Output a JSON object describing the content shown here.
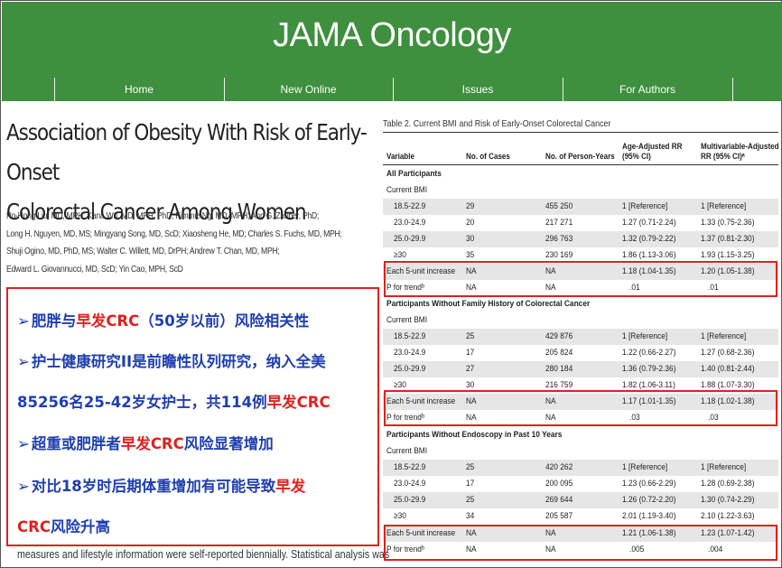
{
  "header": {
    "journal": "JAMA Oncology",
    "nav": [
      "Home",
      "New Online",
      "Issues",
      "For Authors"
    ]
  },
  "article": {
    "title_line1": "Association of Obesity With Risk of Early-Onset",
    "title_line2": "Colorectal Cancer Among Women",
    "authors": [
      "Po-Hong Liu, MD, MPH; Kana Wu, MD, MPH, PhD; Kimmie Ng, MD, MPH; Ann G. Zauber, PhD;",
      "Long H. Nguyen, MD, MS; Mingyang Song, MD, ScD; Xiaosheng He, MD; Charles S. Fuchs, MD, MPH;",
      "Shuji Ogino, MD, PhD, MS; Walter C. Willett, MD, DrPH; Andrew T. Chan, MD, MPH;",
      "Edward L. Giovannucci, MD, ScD; Yin Cao, MPH, ScD"
    ],
    "cutoff_text": "measures and lifestyle information were self-reported biennially. Statistical analysis was"
  },
  "summary": {
    "b1_a": "肥胖与",
    "b1_r": "早发CRC",
    "b1_b": "（50岁以前）风险相关性",
    "b2": "护士健康研究II是前瞻性队列研究，纳入全美",
    "b2_cont_a": "85256名25-42岁女护士，共114例",
    "b2_cont_r": "早发CRC",
    "b3_a": "超重或肥胖者",
    "b3_r": "早发CRC",
    "b3_b": "风险显著增加",
    "b4_a": "对比18岁时后期体重增加有可能导致",
    "b4_r": "早发",
    "b4_cont_r": "CRC",
    "b4_cont_b": "风险升高",
    "arrow": "➢"
  },
  "table": {
    "caption": "Table 2. Current BMI and Risk of Early-Onset Colorectal Cancer",
    "headers": {
      "variable": "Variable",
      "cases": "No. of Cases",
      "person_years": "No. of Person-Years",
      "age_adj_1": "Age-Adjusted RR",
      "age_adj_2": "(95% CI)",
      "multi_1": "Multivariable-Adjusted",
      "multi_2": "RR (95% CI)ᵃ"
    },
    "rows": [
      {
        "v": "All Participants",
        "t": "section",
        "c": "",
        "p": "",
        "a": "",
        "m": ""
      },
      {
        "v": "Current BMI",
        "t": "label",
        "c": "",
        "p": "",
        "a": "",
        "m": ""
      },
      {
        "v": "18.5-22.9",
        "t": "data",
        "c": "29",
        "p": "455 250",
        "a": "1 [Reference]",
        "m": "1 [Reference]"
      },
      {
        "v": "23.0-24.9",
        "t": "data",
        "c": "20",
        "p": "217 271",
        "a": "1.27 (0.71-2.24)",
        "m": "1.33 (0.75-2.36)"
      },
      {
        "v": "25.0-29.9",
        "t": "data",
        "c": "30",
        "p": "296 763",
        "a": "1.32 (0.79-2.22)",
        "m": "1.37 (0.81-2.30)"
      },
      {
        "v": "≥30",
        "t": "data",
        "c": "35",
        "p": "230 169",
        "a": "1.86 (1.13-3.06)",
        "m": "1.93 (1.15-3.25)"
      },
      {
        "v": "Each 5-unit increase",
        "t": "top",
        "c": "NA",
        "p": "NA",
        "a": "1.18 (1.04-1.35)",
        "m": "1.20 (1.05-1.38)"
      },
      {
        "v": "P for trendᵇ",
        "t": "top",
        "c": "NA",
        "p": "NA",
        "a": ".01",
        "m": ".01"
      },
      {
        "v": "Participants Without Family History of Colorectal Cancer",
        "t": "section",
        "c": "",
        "p": "",
        "a": "",
        "m": ""
      },
      {
        "v": "Current BMI",
        "t": "label",
        "c": "",
        "p": "",
        "a": "",
        "m": ""
      },
      {
        "v": "18.5-22.9",
        "t": "data",
        "c": "25",
        "p": "429 876",
        "a": "1 [Reference]",
        "m": "1 [Reference]"
      },
      {
        "v": "23.0-24.9",
        "t": "data",
        "c": "17",
        "p": "205 824",
        "a": "1.22 (0.66-2.27)",
        "m": "1.27 (0.68-2.36)"
      },
      {
        "v": "25.0-29.9",
        "t": "data",
        "c": "27",
        "p": "280 184",
        "a": "1.36 (0.79-2.36)",
        "m": "1.40 (0.81-2.44)"
      },
      {
        "v": "≥30",
        "t": "data",
        "c": "30",
        "p": "216 759",
        "a": "1.82 (1.06-3.11)",
        "m": "1.88 (1.07-3.30)"
      },
      {
        "v": "Each 5-unit increase",
        "t": "top",
        "c": "NA",
        "p": "NA",
        "a": "1.17 (1.01-1.35)",
        "m": "1.18 (1.02-1.38)"
      },
      {
        "v": "P for trendᵇ",
        "t": "top",
        "c": "NA",
        "p": "NA",
        "a": ".03",
        "m": ".03"
      },
      {
        "v": "Participants Without Endoscopy in Past 10 Years",
        "t": "section",
        "c": "",
        "p": "",
        "a": "",
        "m": ""
      },
      {
        "v": "Current BMI",
        "t": "label",
        "c": "",
        "p": "",
        "a": "",
        "m": ""
      },
      {
        "v": "18.5-22.9",
        "t": "data",
        "c": "25",
        "p": "420 262",
        "a": "1 [Reference]",
        "m": "1 [Reference]"
      },
      {
        "v": "23.0-24.9",
        "t": "data",
        "c": "17",
        "p": "200 095",
        "a": "1.23 (0.66-2.29)",
        "m": "1.28 (0.69-2.38)"
      },
      {
        "v": "25.0-29.9",
        "t": "data",
        "c": "25",
        "p": "269 644",
        "a": "1.26 (0.72-2.20)",
        "m": "1.30 (0.74-2.29)"
      },
      {
        "v": "≥30",
        "t": "data",
        "c": "34",
        "p": "205 587",
        "a": "2.01 (1.19-3.40)",
        "m": "2.10 (1.22-3.63)"
      },
      {
        "v": "Each 5-unit increase",
        "t": "top",
        "c": "NA",
        "p": "NA",
        "a": "1.21 (1.06-1.38)",
        "m": "1.23 (1.07-1.42)"
      },
      {
        "v": "P for trendᵇ",
        "t": "top",
        "c": "NA",
        "p": "NA",
        "a": ".005",
        "m": ".004"
      }
    ]
  },
  "colors": {
    "header_green": "#3e8f3e",
    "highlight_red": "#e02020",
    "bullet_blue": "#1f3fb0"
  }
}
